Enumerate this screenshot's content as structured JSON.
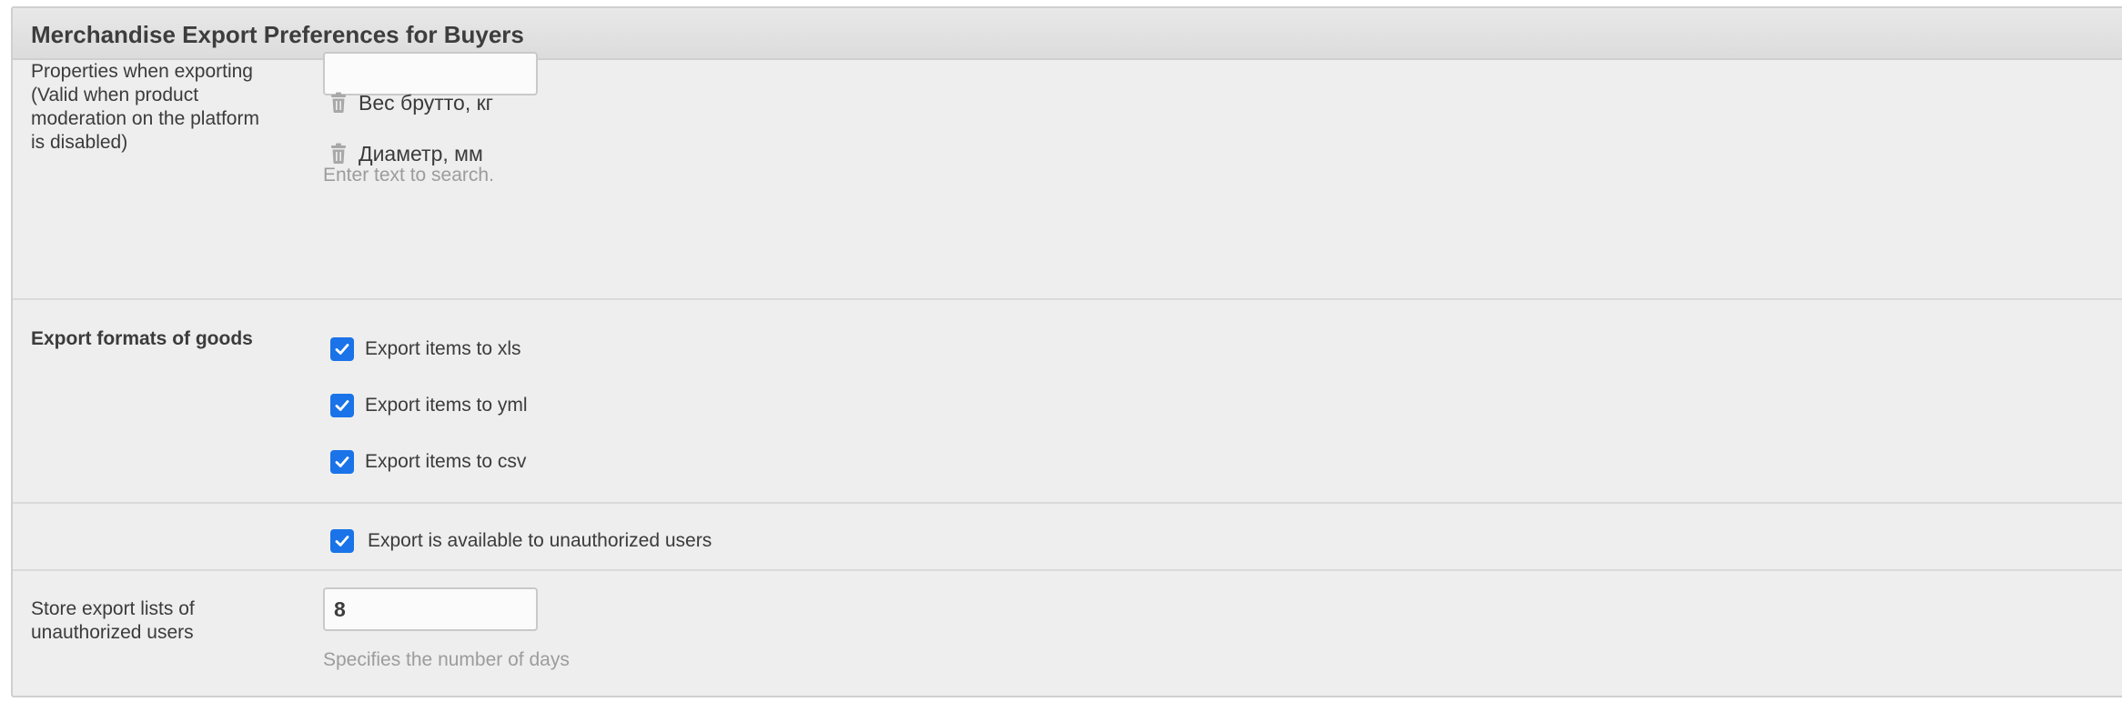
{
  "panel": {
    "title": "Merchandise Export Preferences for Buyers"
  },
  "properties": {
    "label": "Properties when exporting (Valid when product moderation on the platform is disabled)",
    "label_lines": [
      "Properties when exporting",
      "(Valid when product",
      "moderation on the platform",
      "is disabled)"
    ],
    "input_value": "",
    "items": [
      {
        "label": "Вес брутто, кг",
        "icon": "trash-icon"
      },
      {
        "label": "Диаметр, мм",
        "icon": "trash-icon"
      }
    ],
    "hint": "Enter text to search."
  },
  "export_formats": {
    "label": "Export formats of goods",
    "options": [
      {
        "label": "Export items to xls",
        "checked": true
      },
      {
        "label": "Export items to yml",
        "checked": true
      },
      {
        "label": "Export items to csv",
        "checked": true
      }
    ]
  },
  "unauthorized": {
    "label": "Export is available to unauthorized users",
    "checked": true
  },
  "store_lists": {
    "label_lines": [
      "Store export lists of",
      "unauthorized users"
    ],
    "value": "8",
    "hint": "Specifies the number of days"
  },
  "colors": {
    "checkbox": "#1a73e8",
    "panel_bg": "#eeeeee",
    "hint": "#9c9c9c"
  }
}
